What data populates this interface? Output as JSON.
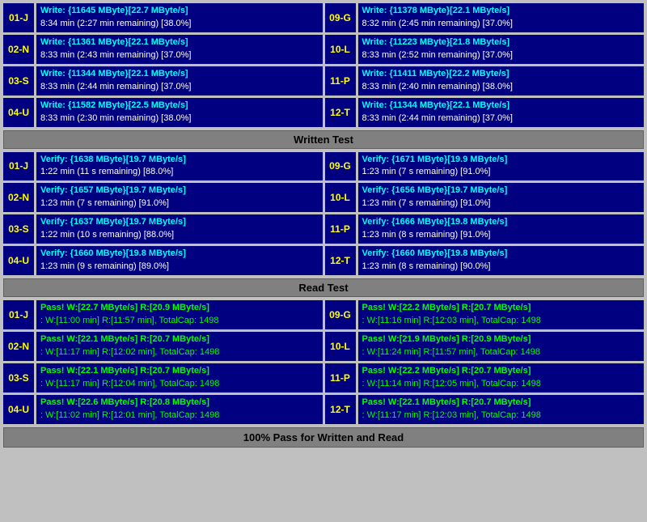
{
  "sections": {
    "write_test": {
      "rows": [
        {
          "left_label": "01-J",
          "left_line1": "Write: {11645 MByte}[22.7 MByte/s]",
          "left_line2": "8:34 min (2:27 min remaining)  [38.0%]",
          "right_label": "09-G",
          "right_line1": "Write: {11378 MByte}[22.1 MByte/s]",
          "right_line2": "8:32 min (2:45 min remaining)  [37.0%]"
        },
        {
          "left_label": "02-N",
          "left_line1": "Write: {11361 MByte}[22.1 MByte/s]",
          "left_line2": "8:33 min (2:43 min remaining)  [37.0%]",
          "right_label": "10-L",
          "right_line1": "Write: {11223 MByte}[21.8 MByte/s]",
          "right_line2": "8:33 min (2:52 min remaining)  [37.0%]"
        },
        {
          "left_label": "03-S",
          "left_line1": "Write: {11344 MByte}[22.1 MByte/s]",
          "left_line2": "8:33 min (2:44 min remaining)  [37.0%]",
          "right_label": "11-P",
          "right_line1": "Write: {11411 MByte}[22.2 MByte/s]",
          "right_line2": "8:33 min (2:40 min remaining)  [38.0%]"
        },
        {
          "left_label": "04-U",
          "left_line1": "Write: {11582 MByte}[22.5 MByte/s]",
          "left_line2": "8:33 min (2:30 min remaining)  [38.0%]",
          "right_label": "12-T",
          "right_line1": "Write: {11344 MByte}[22.1 MByte/s]",
          "right_line2": "8:33 min (2:44 min remaining)  [37.0%]"
        }
      ]
    },
    "written_test_header": "Written Test",
    "verify_test": {
      "rows": [
        {
          "left_label": "01-J",
          "left_line1": "Verify: {1638 MByte}[19.7 MByte/s]",
          "left_line2": "1:22 min (11 s remaining)   [88.0%]",
          "right_label": "09-G",
          "right_line1": "Verify: {1671 MByte}[19.9 MByte/s]",
          "right_line2": "1:23 min (7 s remaining)   [91.0%]"
        },
        {
          "left_label": "02-N",
          "left_line1": "Verify: {1657 MByte}[19.7 MByte/s]",
          "left_line2": "1:23 min (7 s remaining)   [91.0%]",
          "right_label": "10-L",
          "right_line1": "Verify: {1656 MByte}[19.7 MByte/s]",
          "right_line2": "1:23 min (7 s remaining)   [91.0%]"
        },
        {
          "left_label": "03-S",
          "left_line1": "Verify: {1637 MByte}[19.7 MByte/s]",
          "left_line2": "1:22 min (10 s remaining)   [88.0%]",
          "right_label": "11-P",
          "right_line1": "Verify: {1666 MByte}[19.8 MByte/s]",
          "right_line2": "1:23 min (8 s remaining)   [91.0%]"
        },
        {
          "left_label": "04-U",
          "left_line1": "Verify: {1660 MByte}[19.8 MByte/s]",
          "left_line2": "1:23 min (9 s remaining)   [89.0%]",
          "right_label": "12-T",
          "right_line1": "Verify: {1660 MByte}[19.8 MByte/s]",
          "right_line2": "1:23 min (8 s remaining)   [90.0%]"
        }
      ]
    },
    "read_test_header": "Read Test",
    "pass_test": {
      "rows": [
        {
          "left_label": "01-J",
          "left_line1": "Pass! W:[22.7 MByte/s] R:[20.9 MByte/s]",
          "left_line2": ": W:[11:00 min] R:[11:57 min], TotalCap: 1498",
          "right_label": "09-G",
          "right_line1": "Pass! W:[22.2 MByte/s] R:[20.7 MByte/s]",
          "right_line2": ": W:[11:16 min] R:[12:03 min], TotalCap: 1498"
        },
        {
          "left_label": "02-N",
          "left_line1": "Pass! W:[22.1 MByte/s] R:[20.7 MByte/s]",
          "left_line2": ": W:[11:17 min] R:[12:02 min], TotalCap: 1498",
          "right_label": "10-L",
          "right_line1": "Pass! W:[21.9 MByte/s] R:[20.9 MByte/s]",
          "right_line2": ": W:[11:24 min] R:[11:57 min], TotalCap: 1498"
        },
        {
          "left_label": "03-S",
          "left_line1": "Pass! W:[22.1 MByte/s] R:[20.7 MByte/s]",
          "left_line2": ": W:[11:17 min] R:[12:04 min], TotalCap: 1498",
          "right_label": "11-P",
          "right_line1": "Pass! W:[22.2 MByte/s] R:[20.7 MByte/s]",
          "right_line2": ": W:[11:14 min] R:[12:05 min], TotalCap: 1498"
        },
        {
          "left_label": "04-U",
          "left_line1": "Pass! W:[22.6 MByte/s] R:[20.8 MByte/s]",
          "left_line2": ": W:[11:02 min] R:[12:01 min], TotalCap: 1498",
          "right_label": "12-T",
          "right_line1": "Pass! W:[22.1 MByte/s] R:[20.7 MByte/s]",
          "right_line2": ": W:[11:17 min] R:[12:03 min], TotalCap: 1498"
        }
      ]
    },
    "footer": "100% Pass for Written and Read"
  }
}
